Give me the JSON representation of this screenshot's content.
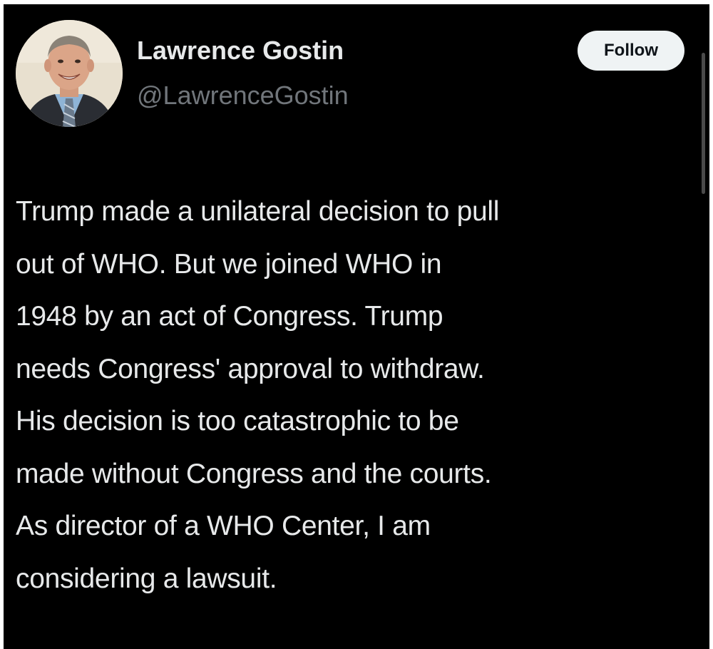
{
  "author": {
    "display_name": "Lawrence Gostin",
    "handle": "@LawrenceGostin",
    "avatar_icon": "profile-photo"
  },
  "actions": {
    "follow_label": "Follow"
  },
  "tweet": {
    "text": "Trump made a unilateral decision to pull\nout of WHO. But we joined WHO in\n1948 by an act of Congress. Trump\nneeds Congress' approval to withdraw.\nHis decision is too catastrophic to be\nmade without Congress and the courts.\nAs director of a WHO Center, I am\nconsidering a lawsuit."
  },
  "colors": {
    "background": "#000000",
    "primary_text": "#e7e9ea",
    "secondary_text": "#71767b",
    "follow_button_bg": "#eff3f4",
    "follow_button_text": "#0f1419"
  }
}
